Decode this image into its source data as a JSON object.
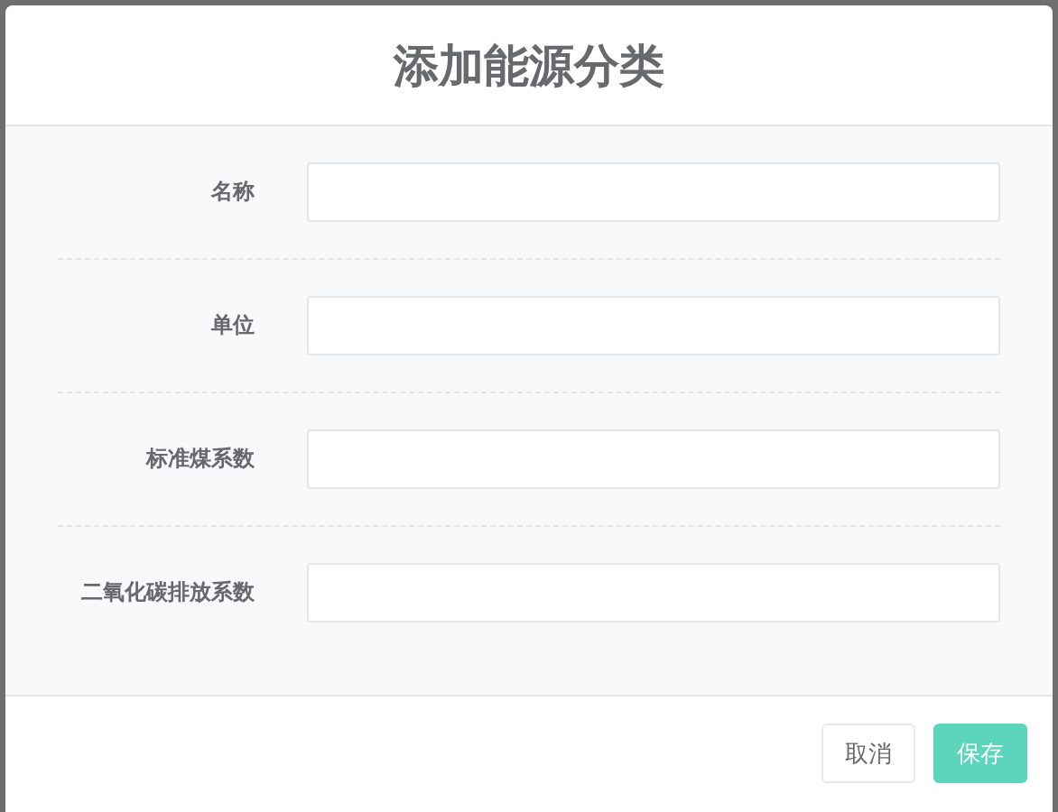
{
  "dialog": {
    "title": "添加能源分类"
  },
  "fields": [
    {
      "label": "名称"
    },
    {
      "label": "单位"
    },
    {
      "label": "标准煤系数"
    },
    {
      "label": "二氧化碳排放系数"
    }
  ],
  "buttons": [
    {
      "label": "取消",
      "kind": "secondary"
    },
    {
      "label": "保存",
      "kind": "primary"
    }
  ]
}
